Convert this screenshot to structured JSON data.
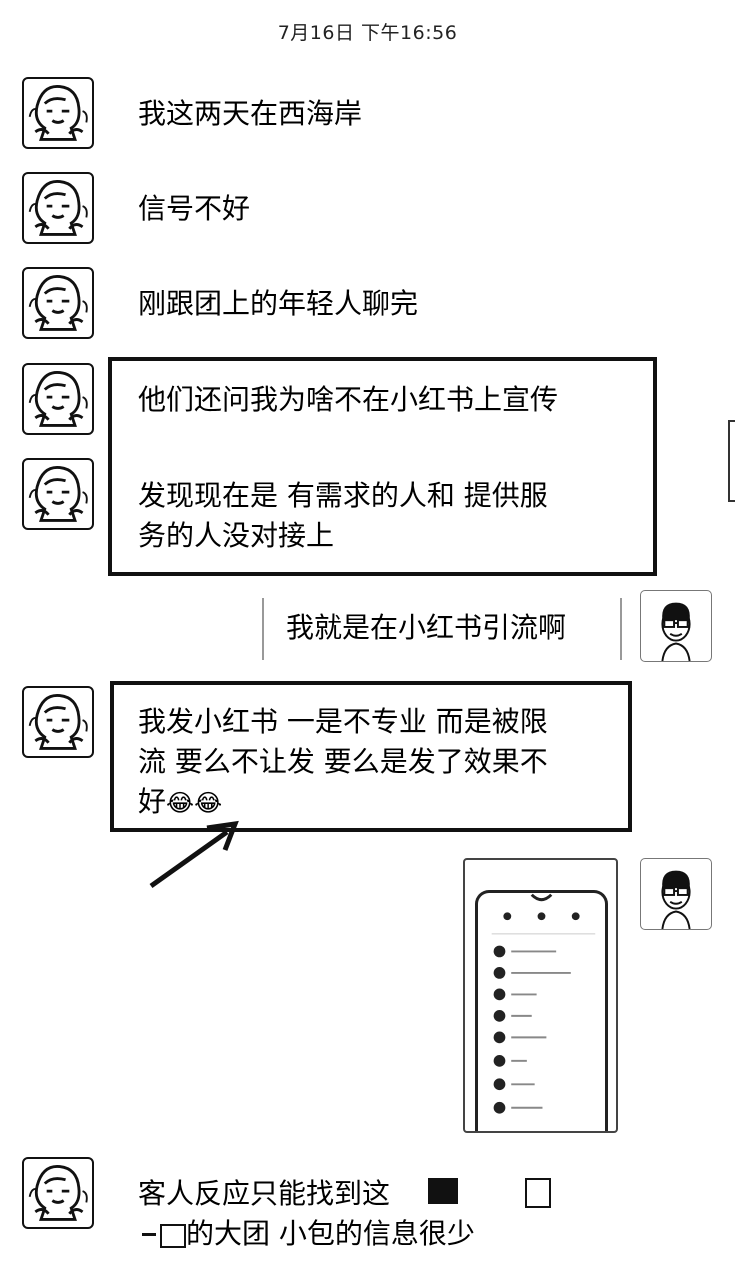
{
  "header": {
    "timestamp": "7月16日 下午16:56"
  },
  "messages": [
    {
      "text": "我这两天在西海岸"
    },
    {
      "text": "信号不好"
    },
    {
      "text": "刚跟团上的年轻人聊完"
    },
    {
      "text": "他们还问我为啥不在小红书上宣传"
    },
    {
      "line1": "发现现在是 有需求的人和 提供服",
      "line2": "务的人没对接上"
    },
    {
      "text": "我就是在小红书引流啊"
    },
    {
      "line1": "我发小红书 一是不专业 而是被限",
      "line2": "流 要么不让发 要么是发了效果不",
      "line3": "好"
    },
    {
      "image": "phone-screenshot"
    },
    {
      "line1": "客人反应只能找到这",
      "line2": "的大团  小包的信息很少"
    }
  ],
  "emoji": {
    "laugh_tears": "😂"
  }
}
